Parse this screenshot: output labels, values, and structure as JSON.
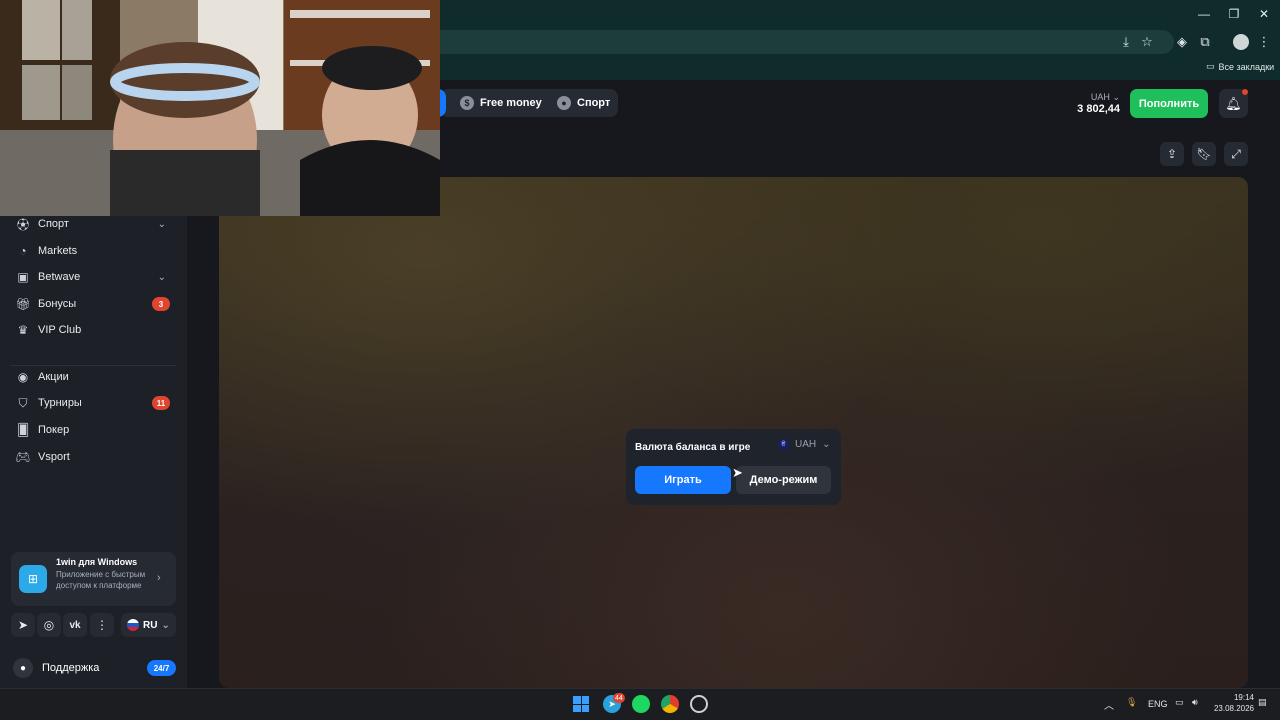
{
  "browser": {
    "bookmarks_label": "Все закладки"
  },
  "header": {
    "nav_partial_label": "",
    "free_money_label": "Free money",
    "sport_label": "Спорт",
    "currency_label": "UAH",
    "balance": "3 802,44",
    "deposit_label": "Пополнить"
  },
  "sidebar": {
    "items": [
      {
        "label": "Спорт",
        "icon": "ball-icon",
        "chevron": true
      },
      {
        "label": "Markets",
        "icon": "markets-icon"
      },
      {
        "label": "Betwave",
        "icon": "betwave-icon",
        "chevron": true
      },
      {
        "label": "Бонусы",
        "icon": "gift-icon",
        "badge": "3"
      },
      {
        "label": "VIP Club",
        "icon": "crown-icon"
      },
      {
        "label": "Акции",
        "icon": "promo-icon"
      },
      {
        "label": "Турниры",
        "icon": "shield-icon",
        "badge": "11"
      },
      {
        "label": "Покер",
        "icon": "cards-icon"
      },
      {
        "label": "Vsport",
        "icon": "gamepad-icon"
      }
    ],
    "app_promo": {
      "title": "1win для Windows",
      "text": "Приложение с быстрым доступом к платформе"
    },
    "language": "RU",
    "support_label": "Поддержка",
    "support_badge": "24/7"
  },
  "modal": {
    "title": "Валюта баланса в игре",
    "currency": "UAH",
    "play_label": "Играть",
    "demo_label": "Демо-режим"
  },
  "taskbar": {
    "lang": "ENG",
    "time": "19:14",
    "date": "23.08.2026",
    "telegram_badge": "44"
  },
  "colors": {
    "accent_blue": "#1677ff",
    "accent_green": "#1fbf5b",
    "badge_red": "#e0452f",
    "chrome_teal": "#0f2b2b"
  }
}
